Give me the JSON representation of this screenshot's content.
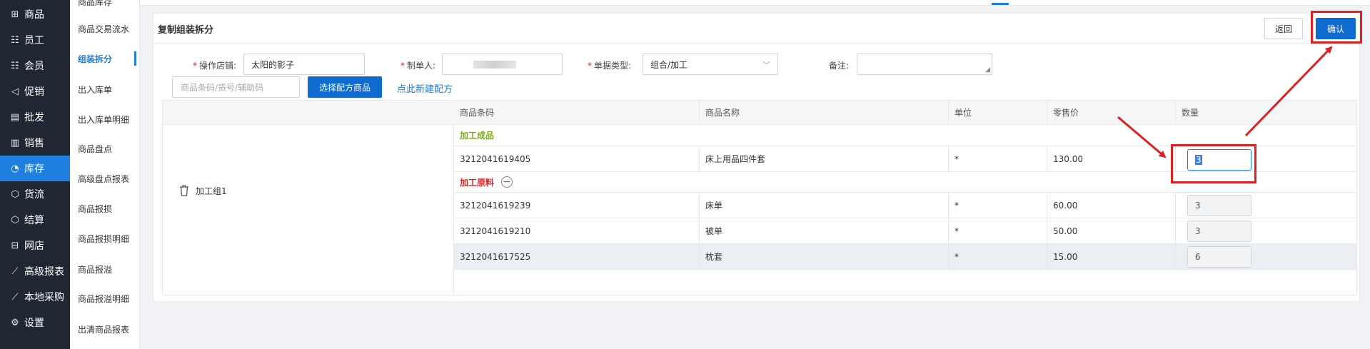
{
  "nav": {
    "items": [
      {
        "label": "商品",
        "icon": "grid-icon",
        "glyph": "⊞"
      },
      {
        "label": "员工",
        "icon": "user-card-icon",
        "glyph": "☷"
      },
      {
        "label": "会员",
        "icon": "member-icon",
        "glyph": "☷"
      },
      {
        "label": "促销",
        "icon": "megaphone-icon",
        "glyph": "◁"
      },
      {
        "label": "批发",
        "icon": "wholesale-icon",
        "glyph": "▤"
      },
      {
        "label": "销售",
        "icon": "bar-chart-icon",
        "glyph": "▥"
      },
      {
        "label": "库存",
        "icon": "pie-chart-icon",
        "glyph": "◔"
      },
      {
        "label": "货流",
        "icon": "cube-icon",
        "glyph": "⬡"
      },
      {
        "label": "结算",
        "icon": "cube-icon",
        "glyph": "⬡"
      },
      {
        "label": "网店",
        "icon": "gift-icon",
        "glyph": "⊟"
      },
      {
        "label": "高级报表",
        "icon": "line-chart-icon",
        "glyph": "⟋"
      },
      {
        "label": "本地采购",
        "icon": "trend-icon",
        "glyph": "⟋"
      },
      {
        "label": "设置",
        "icon": "gear-icon",
        "glyph": "⚙"
      }
    ],
    "active_index": 6
  },
  "submenu": {
    "items": [
      "商品库存",
      "商品交易流水",
      "组装拆分",
      "出入库单",
      "出入库单明细",
      "商品盘点",
      "高级盘点报表",
      "商品报损",
      "商品报损明细",
      "商品报溢",
      "商品报溢明细",
      "出清商品报表"
    ],
    "active_index": 2
  },
  "panel": {
    "title": "复制组装拆分",
    "back_label": "返回",
    "confirm_label": "确认"
  },
  "form": {
    "store_label": "操作店铺:",
    "store_value": "太阳的影子",
    "maker_label": "制单人:",
    "type_label": "单据类型:",
    "type_value": "组合/加工",
    "remark_label": "备注:",
    "search_placeholder": "商品条码/货号/辅助码",
    "choose_label": "选择配方商品",
    "new_recipe_link": "点此新建配方"
  },
  "table": {
    "headers": [
      "商品条码",
      "商品名称",
      "单位",
      "零售价",
      "数量"
    ],
    "group_label": "加工组1",
    "finished_title": "加工成品",
    "raw_title": "加工原料",
    "finished_rows": [
      {
        "barcode": "3212041619405",
        "name": "床上用品四件套",
        "unit": "*",
        "price": "130.00",
        "qty": "3"
      }
    ],
    "raw_rows": [
      {
        "barcode": "3212041619239",
        "name": "床单",
        "unit": "*",
        "price": "60.00",
        "qty": "3"
      },
      {
        "barcode": "3212041619210",
        "name": "被单",
        "unit": "*",
        "price": "50.00",
        "qty": "3"
      },
      {
        "barcode": "3212041617525",
        "name": "枕套",
        "unit": "*",
        "price": "15.00",
        "qty": "6"
      }
    ]
  },
  "colors": {
    "accent": "#1f7fe0",
    "sidebar": "#1f2733",
    "annotation": "#e02020",
    "finished": "#7aad1a"
  }
}
